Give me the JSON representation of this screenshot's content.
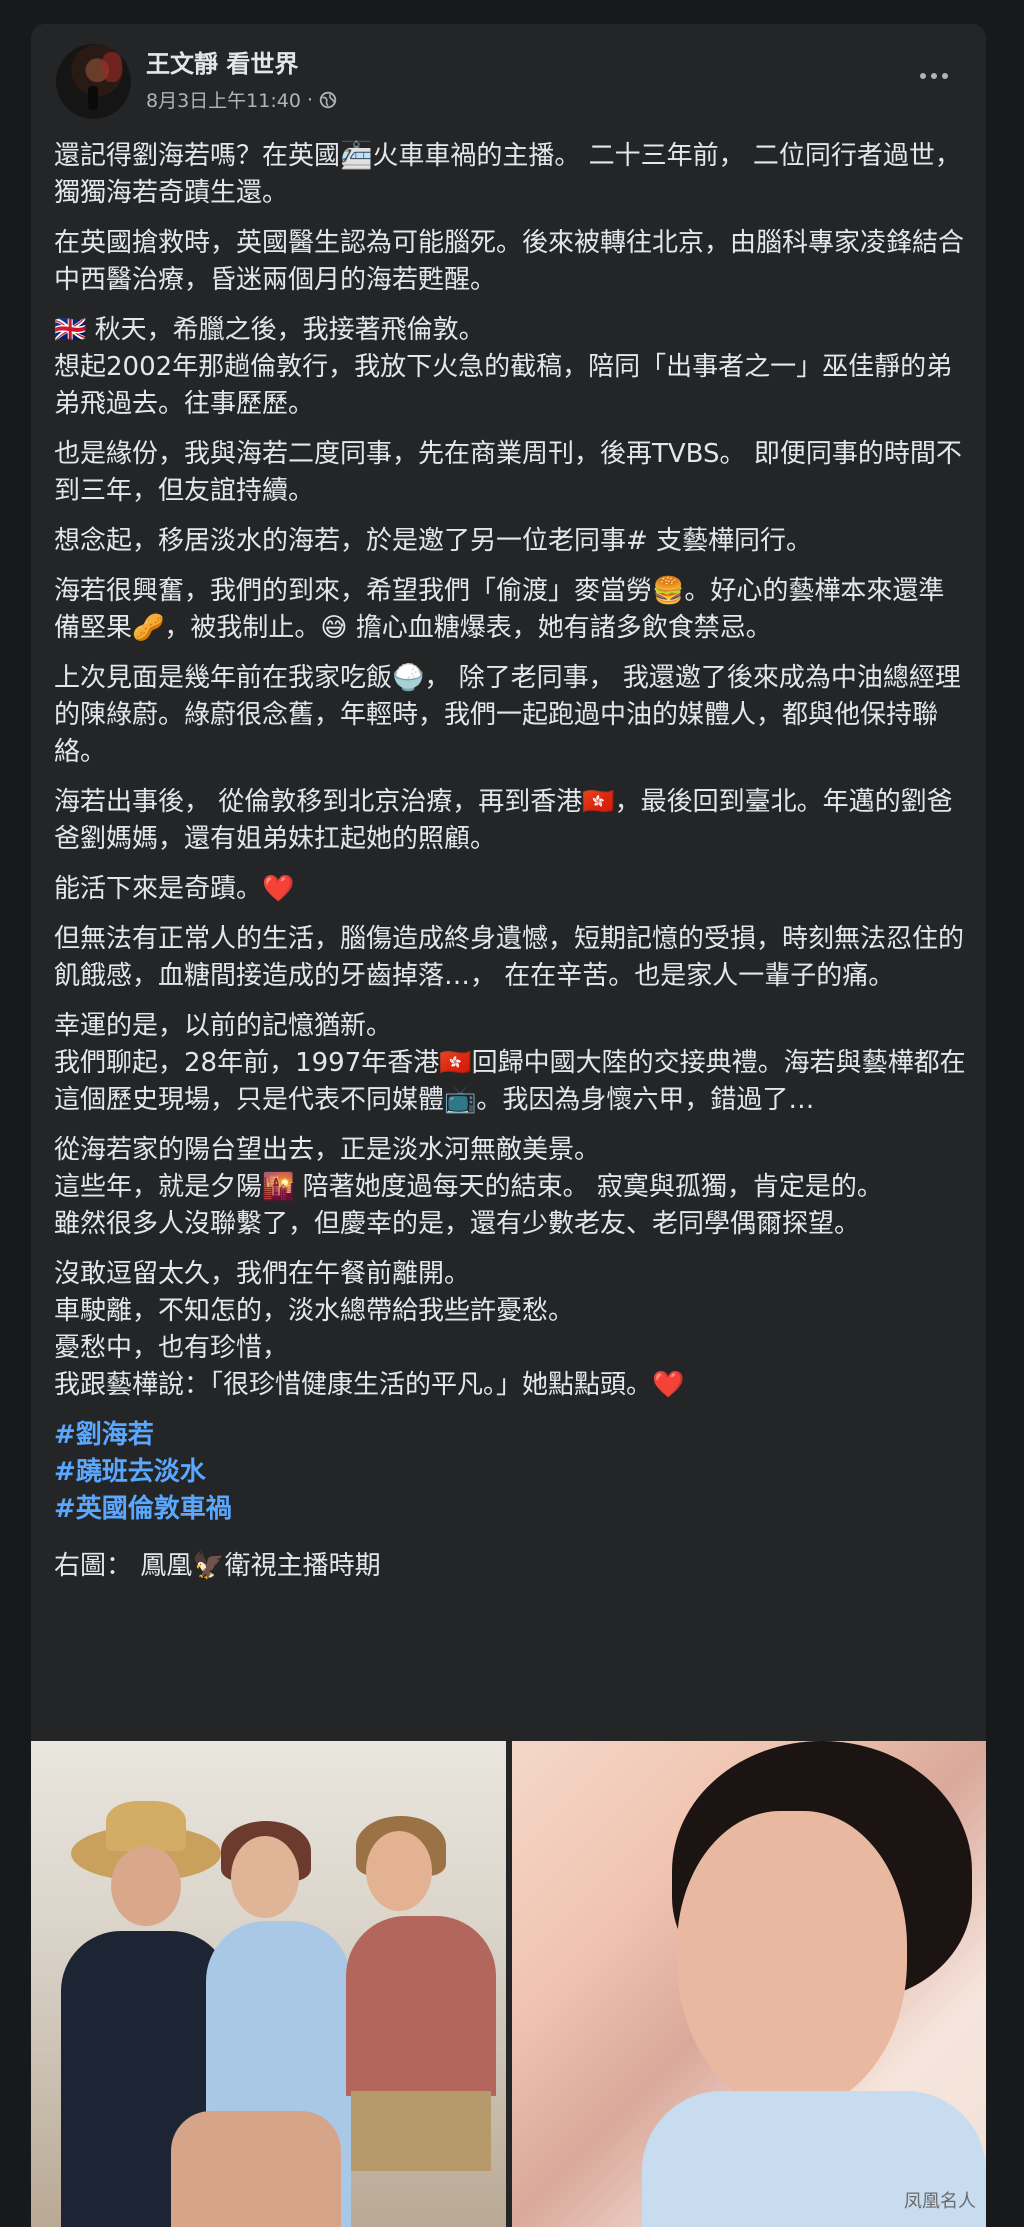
{
  "post": {
    "author": "王文靜 看世界",
    "timestamp": "8月3日上午11:40",
    "audience_icon": "globe-icon",
    "more_icon": "more-options-icon"
  },
  "paragraphs": [
    "還記得劉海若嗎？在英國🚈火車車禍的主播。 二十三年前， 二位同行者過世，獨獨海若奇蹟生還。",
    "在英國搶救時，英國醫生認為可能腦死。後來被轉往北京，由腦科專家凌鋒結合中西醫治療，昏迷兩個月的海若甦醒。",
    "🇬🇧 秋天，希臘之後，我接著飛倫敦。\n想起2002年那趟倫敦行，我放下火急的截稿，陪同「出事者之一」巫佳靜的弟弟飛過去。往事歷歷。",
    "也是緣份，我與海若二度同事，先在商業周刊，後再TVBS。 即便同事的時間不到三年，但友誼持續。",
    "想念起，移居淡水的海若，於是邀了另一位老同事# 支藝樺同行。",
    "海若很興奮，我們的到來，希望我們「偷渡」麥當勞🍔。好心的藝樺本來還準備堅果🥜，被我制止。😅 擔心血糖爆表，她有諸多飲食禁忌。",
    "上次見面是幾年前在我家吃飯🍚， 除了老同事， 我還邀了後來成為中油總經理的陳綠蔚。綠蔚很念舊，年輕時，我們一起跑過中油的媒體人，都與他保持聯絡。",
    "海若出事後， 從倫敦移到北京治療，再到香港🇭🇰，最後回到臺北。年邁的劉爸爸劉媽媽，還有姐弟妹扛起她的照顧。",
    "能活下來是奇蹟。❤️",
    "但無法有正常人的生活，腦傷造成終身遺憾，短期記憶的受損，時刻無法忍住的飢餓感，血糖間接造成的牙齒掉落…， 在在辛苦。也是家人一輩子的痛。",
    "幸運的是，以前的記憶猶新。\n我們聊起，28年前，1997年香港🇭🇰回歸中國大陸的交接典禮。海若與藝樺都在這個歷史現場，只是代表不同媒體📺。我因為身懷六甲，錯過了…",
    "從海若家的陽台望出去，正是淡水河無敵美景。\n這些年，就是夕陽🌇 陪著她度過每天的結束。 寂寞與孤獨，肯定是的。\n雖然很多人沒聯繫了，但慶幸的是，還有少數老友、老同學偶爾探望。",
    "沒敢逗留太久，我們在午餐前離開。\n車駛離，不知怎的，淡水總帶給我些許憂愁。\n憂愁中，也有珍惜，\n我跟藝樺說：「很珍惜健康生活的平凡。」她點點頭。❤️"
  ],
  "hashtags": [
    "#劉海若",
    "#蹺班去淡水",
    "#英國倫敦車禍"
  ],
  "caption": "右圖： 鳳凰🦅衛視主播時期",
  "photos": {
    "left_alt": "three-women-on-sofa-photo",
    "right_alt": "anchor-portrait-photo",
    "watermark": "凤凰名人"
  }
}
